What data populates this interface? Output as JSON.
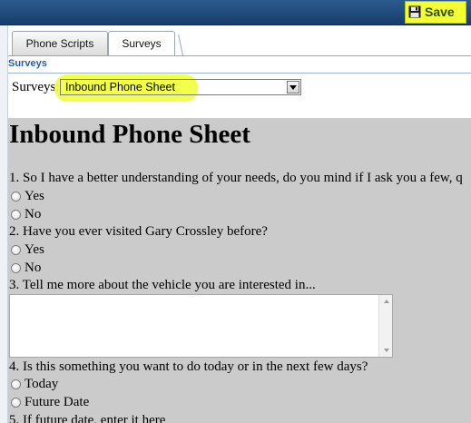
{
  "toolbar": {
    "save_label": "Save",
    "save_icon": "floppy-disk-icon",
    "highlight_color": "#f4ff33"
  },
  "tabs": [
    {
      "label": "Phone Scripts",
      "active": false
    },
    {
      "label": "Surveys",
      "active": true
    }
  ],
  "section": {
    "title": "Surveys"
  },
  "survey_select": {
    "label": "Surveys:",
    "selected": "Inbound Phone Sheet"
  },
  "survey": {
    "title": "Inbound Phone Sheet",
    "questions": [
      {
        "text": "1. So I have a better understanding of your needs, do you mind if I ask you a few, q",
        "options": [
          "Yes",
          "No"
        ]
      },
      {
        "text": "2. Have you ever visited Gary Crossley before?",
        "options": [
          "Yes",
          "No"
        ]
      },
      {
        "text": "3. Tell me more about the vehicle you are interested in..."
      },
      {
        "text": "4. Is this something you want to do today or in the next few days?",
        "options": [
          "Today",
          "Future Date"
        ]
      },
      {
        "text": "5. If future date, enter it here"
      }
    ]
  }
}
